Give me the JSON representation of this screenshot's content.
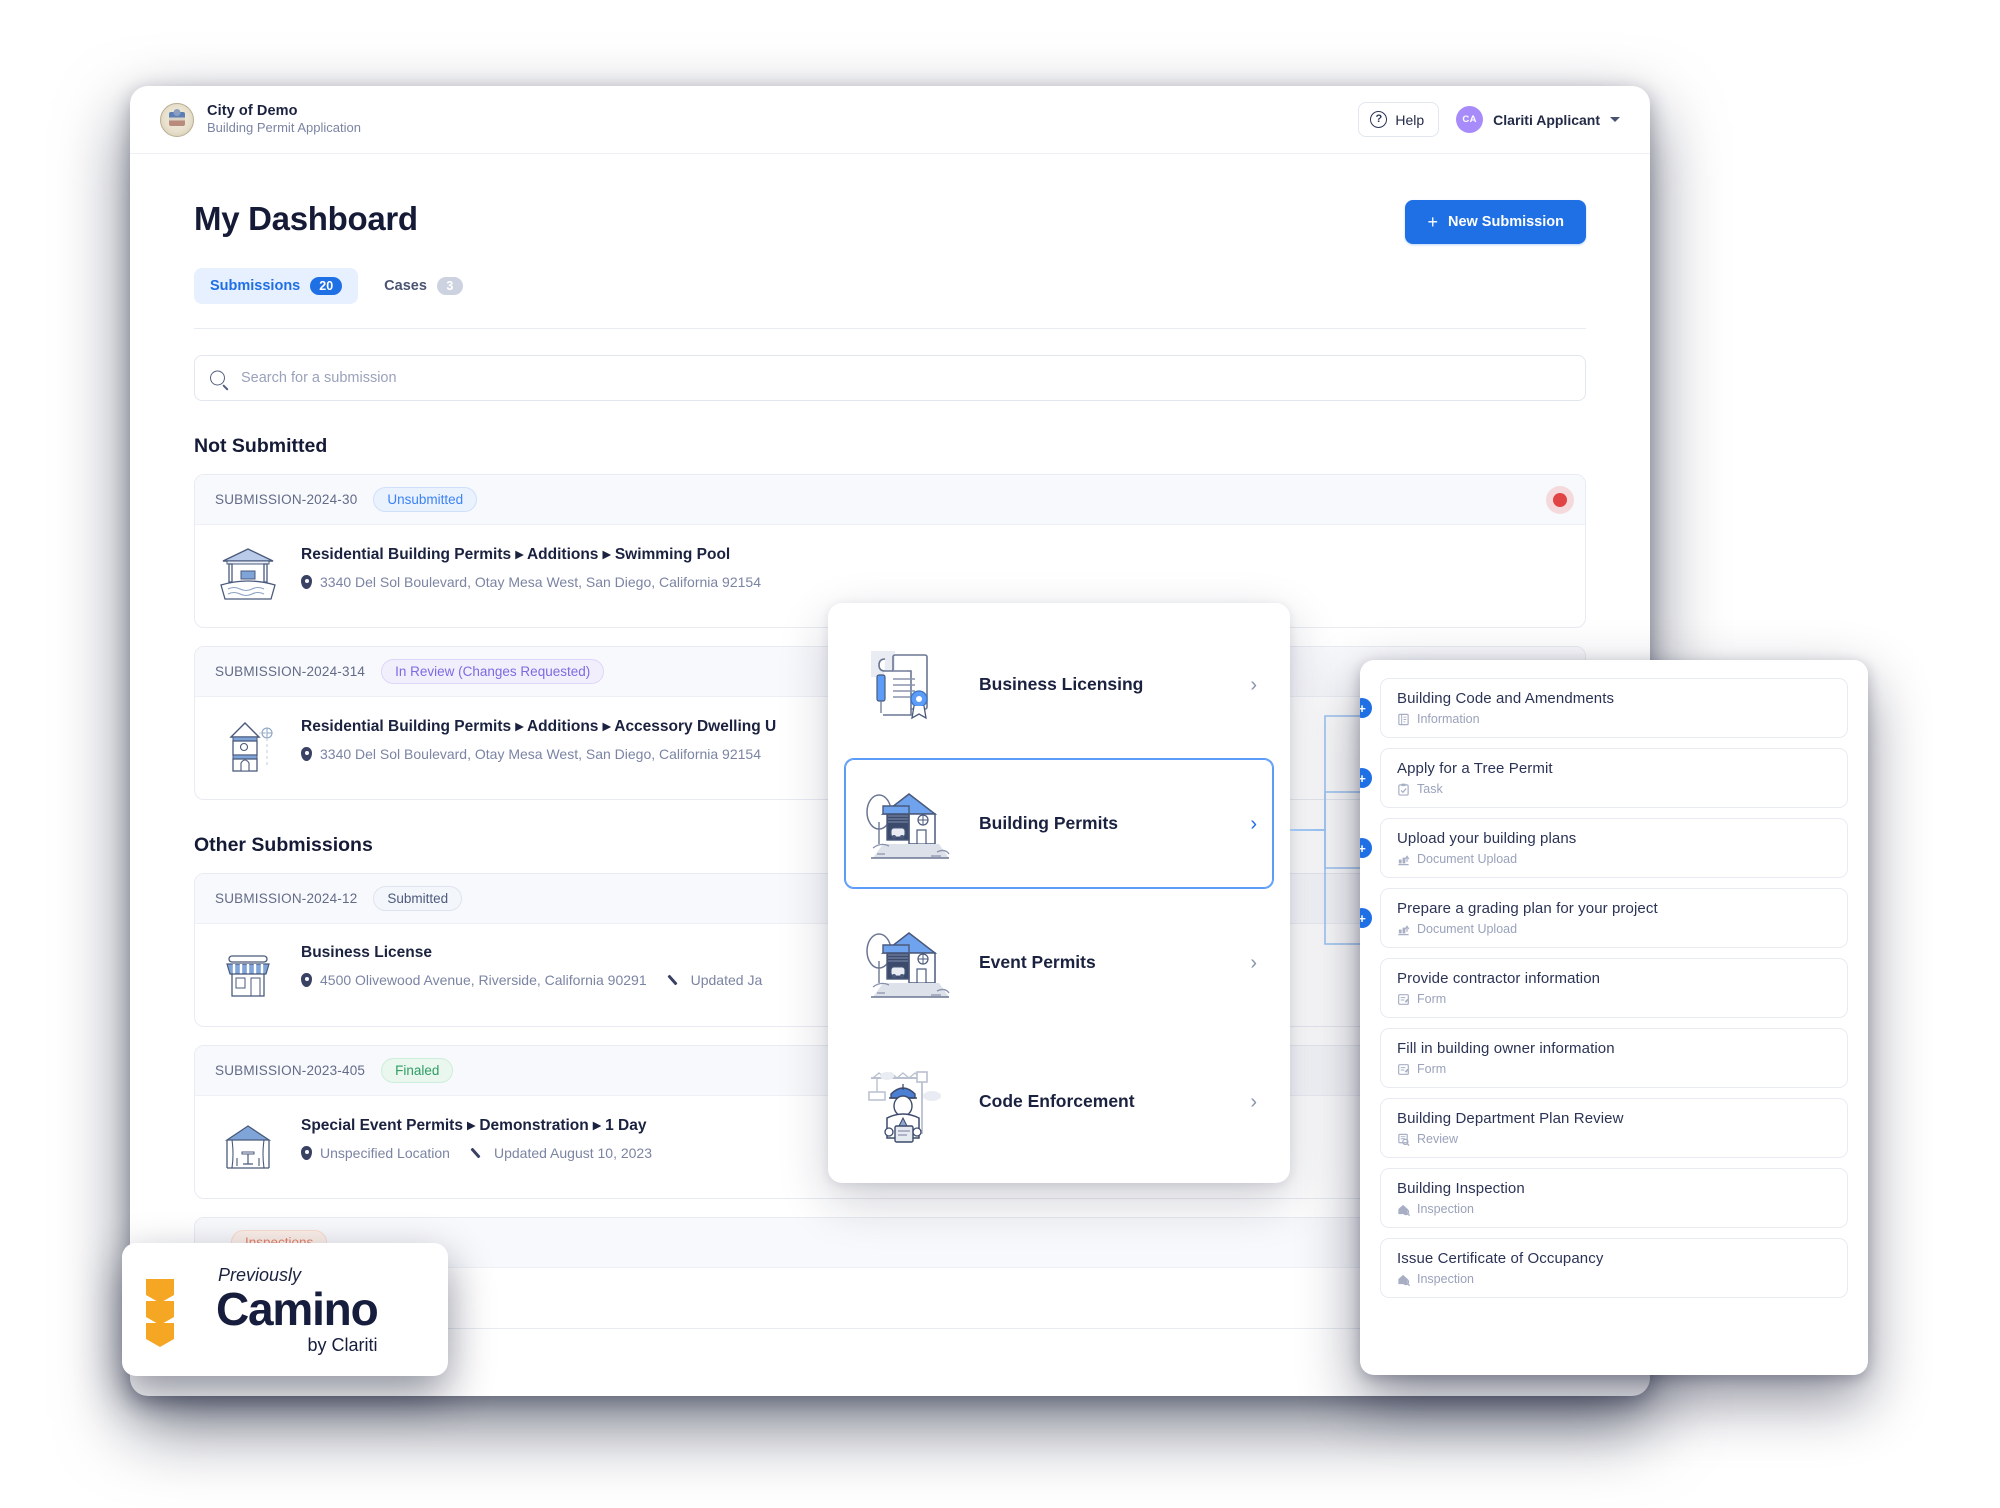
{
  "header": {
    "org_name": "City of Demo",
    "app_name": "Building Permit Application",
    "help_label": "Help",
    "user_initials": "CA",
    "user_name": "Clariti Applicant"
  },
  "page": {
    "title": "My Dashboard",
    "new_submission_label": "New Submission",
    "tabs": [
      {
        "label": "Submissions",
        "count": "20",
        "active": true
      },
      {
        "label": "Cases",
        "count": "3",
        "active": false
      }
    ],
    "search_placeholder": "Search for a submission"
  },
  "sections": [
    {
      "heading": "Not Submitted",
      "submissions": [
        {
          "id": "SUBMISSION-2024-30",
          "status": "Unsubmitted",
          "status_kind": "unsubmitted",
          "title": "Residential Building Permits ▸ Additions ▸ Swimming Pool",
          "location": "3340 Del Sol Boulevard, Otay Mesa West, San Diego, California 92154",
          "updated": "",
          "thumb": "pool-icon",
          "has_alert": true
        },
        {
          "id": "SUBMISSION-2024-314",
          "status": "In Review (Changes Requested)",
          "status_kind": "inreview",
          "title": "Residential Building Permits ▸ Additions ▸ Accessory Dwelling U",
          "location": "3340 Del Sol Boulevard, Otay Mesa West, San Diego, California 92154",
          "updated": "",
          "thumb": "adu-icon",
          "has_alert": false
        }
      ]
    },
    {
      "heading": "Other Submissions",
      "submissions": [
        {
          "id": "SUBMISSION-2024-12",
          "status": "Submitted",
          "status_kind": "submitted",
          "title": "Business License",
          "location": "4500 Olivewood Avenue, Riverside, California 90291",
          "updated": "Updated Ja",
          "thumb": "storefront-icon",
          "has_alert": false
        },
        {
          "id": "SUBMISSION-2023-405",
          "status": "Finaled",
          "status_kind": "finaled",
          "title": "Special Event Permits ▸ Demonstration ▸ 1 Day",
          "location": "Unspecified Location",
          "updated": "Updated August 10, 2023",
          "thumb": "tent-icon",
          "has_alert": false
        },
        {
          "id": "",
          "status": "Inspections",
          "status_kind": "inspections",
          "title": "",
          "location": "",
          "updated": "",
          "thumb": "",
          "has_alert": false
        }
      ]
    }
  ],
  "category_panel": {
    "items": [
      {
        "label": "Business Licensing",
        "art": "license-document-icon",
        "selected": false
      },
      {
        "label": "Building Permits",
        "art": "house-garage-icon",
        "selected": true
      },
      {
        "label": "Event Permits",
        "art": "house-garage-icon",
        "selected": false
      },
      {
        "label": "Code Enforcement",
        "art": "inspector-crane-icon",
        "selected": false
      }
    ]
  },
  "workflow_panel": {
    "items": [
      {
        "title": "Building Code and Amendments",
        "type": "Information",
        "type_icon": "information-icon",
        "has_node": true
      },
      {
        "title": "Apply for a Tree Permit",
        "type": "Task",
        "type_icon": "task-icon",
        "has_node": true
      },
      {
        "title": "Upload your building plans",
        "type": "Document Upload",
        "type_icon": "upload-icon",
        "has_node": true
      },
      {
        "title": "Prepare a grading plan for your project",
        "type": "Document Upload",
        "type_icon": "upload-icon",
        "has_node": true
      },
      {
        "title": "Provide contractor information",
        "type": "Form",
        "type_icon": "form-icon",
        "has_node": false
      },
      {
        "title": "Fill in building owner information",
        "type": "Form",
        "type_icon": "form-icon",
        "has_node": false
      },
      {
        "title": "Building Department Plan Review",
        "type": "Review",
        "type_icon": "review-icon",
        "has_node": false
      },
      {
        "title": "Building Inspection",
        "type": "Inspection",
        "type_icon": "inspection-icon",
        "has_node": false
      },
      {
        "title": "Issue Certificate of Occupancy",
        "type": "Inspection",
        "type_icon": "inspection-icon",
        "has_node": false
      }
    ]
  },
  "camino_badge": {
    "previously": "Previously",
    "name": "Camino",
    "by": "by Clariti"
  },
  "colors": {
    "accent_blue": "#1f6fe5",
    "alert_red": "#e04444",
    "camino_orange": "#f5a623",
    "camino_navy": "#171d3d"
  }
}
